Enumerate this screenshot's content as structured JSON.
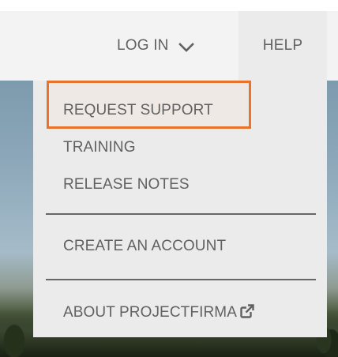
{
  "nav": {
    "login_label": "LOG IN",
    "help_label": "HELP"
  },
  "dropdown": {
    "items": [
      {
        "label": "REQUEST SUPPORT",
        "highlighted": true
      },
      {
        "label": "TRAINING"
      },
      {
        "label": "RELEASE NOTES"
      },
      {
        "label": "CREATE AN ACCOUNT"
      },
      {
        "label": "ABOUT PROJECTFIRMA",
        "icon": "external-link-icon"
      }
    ]
  },
  "colors": {
    "nav_background": "#f3f3f3",
    "dropdown_background": "#ebebeb",
    "text": "#616161",
    "highlight_border": "#e8742c"
  }
}
